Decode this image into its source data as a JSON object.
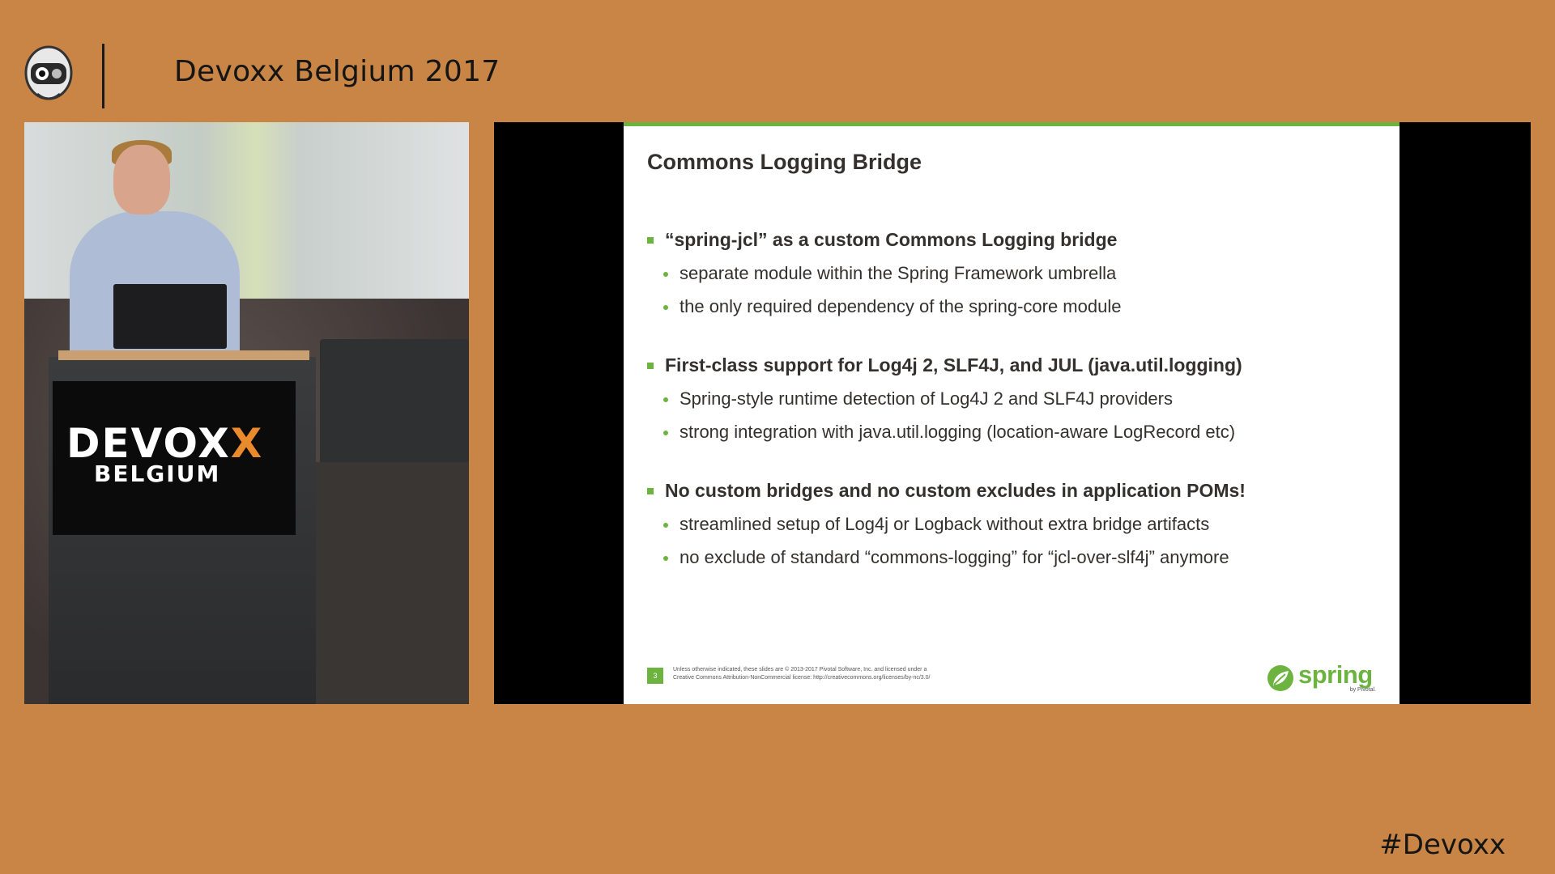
{
  "header": {
    "event_title": "Devoxx Belgium 2017",
    "logo_icon": "devoxx-robot-logo-icon"
  },
  "footer": {
    "hashtag": "#Devoxx"
  },
  "speaker_video": {
    "sign_word_prefix": "DEVOX",
    "sign_word_x": "X",
    "sign_sub": "BELGIUM"
  },
  "slide": {
    "title": "Commons Logging Bridge",
    "accent_color": "#6db33f",
    "groups": [
      {
        "main": "“spring-jcl” as a custom Commons Logging bridge",
        "subs": [
          "separate module within the Spring Framework umbrella",
          "the only required dependency of the spring-core module"
        ]
      },
      {
        "main": "First-class support for Log4j 2, SLF4J, and JUL (java.util.logging)",
        "subs": [
          "Spring-style runtime detection of Log4J 2 and SLF4J providers",
          "strong integration with java.util.logging (location-aware LogRecord etc)"
        ]
      },
      {
        "main": "No custom bridges and no custom excludes in application POMs!",
        "subs": [
          "streamlined setup of Log4j or Logback without extra bridge artifacts",
          "no exclude of standard “commons-logging” for “jcl-over-slf4j” anymore"
        ]
      }
    ],
    "page_number": "3",
    "license_line1": "Unless otherwise indicated, these slides are © 2013-2017 Pivotal Software, Inc. and licensed under a",
    "license_line2": "Creative Commons Attribution-NonCommercial license: http://creativecommons.org/licenses/by-nc/3.0/",
    "brand": "spring",
    "brand_by": "by Pivotal."
  }
}
